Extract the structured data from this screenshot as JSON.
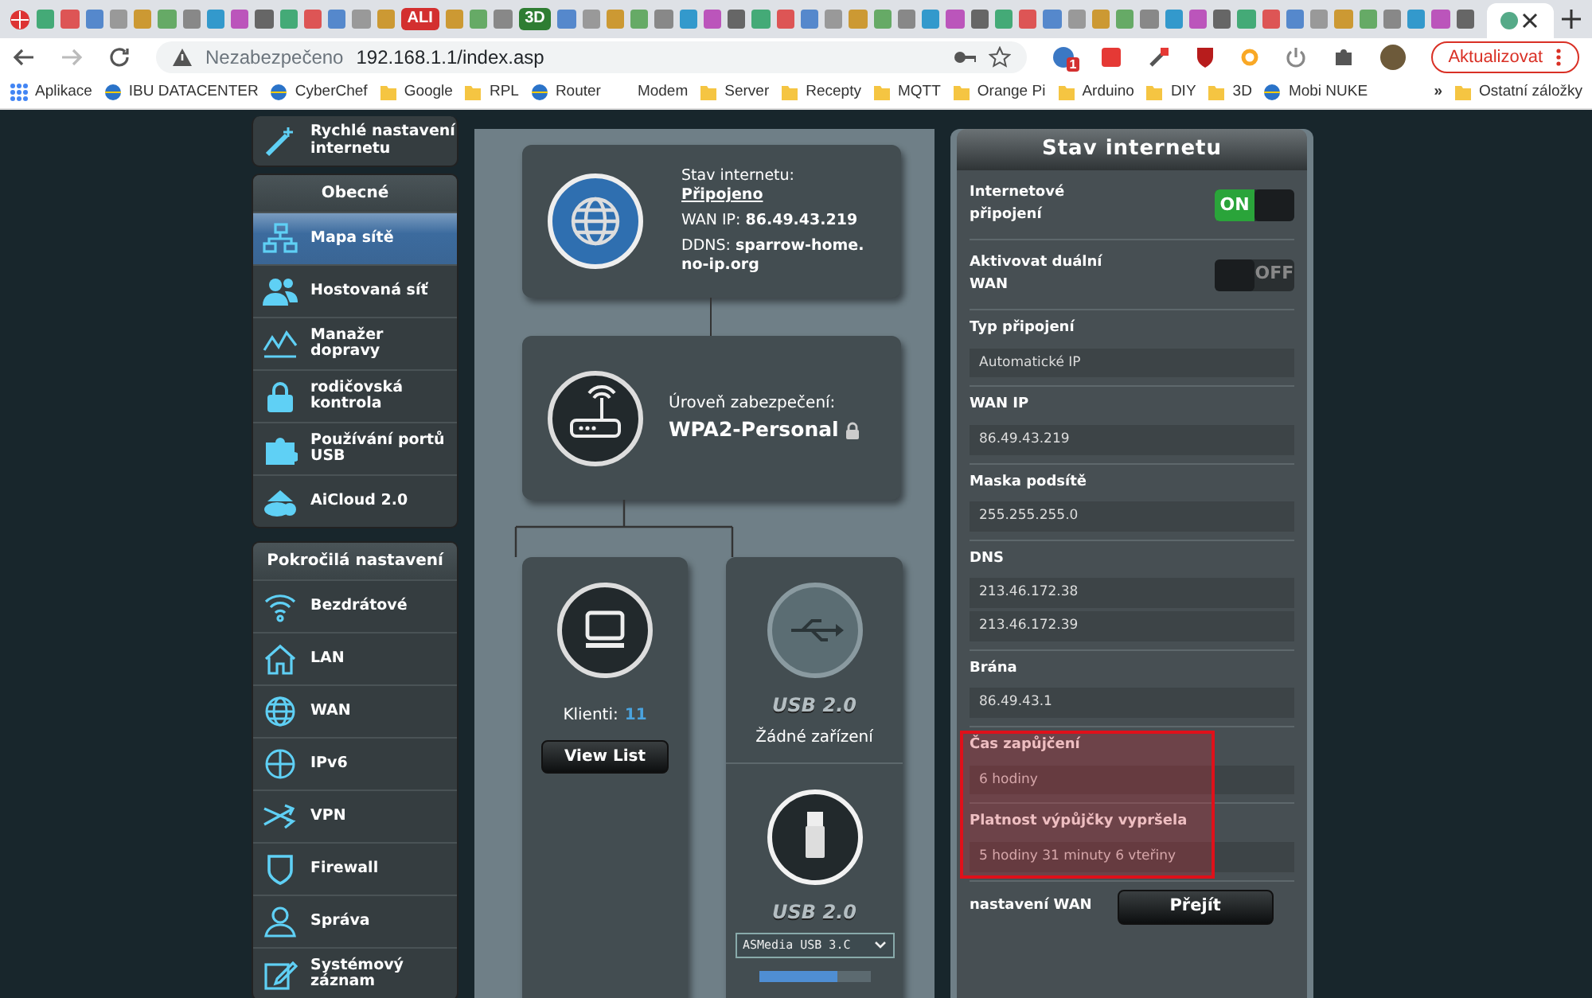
{
  "browser": {
    "tab_badges": [
      {
        "label": "ALI",
        "color": "#d32f2f"
      },
      {
        "label": "3D",
        "color": "#2e7d32"
      }
    ],
    "address": {
      "security": "Nezabezpečeno",
      "url": "192.168.1.1/index.asp"
    },
    "update_button": "Aktualizovat",
    "extension_badge": "1",
    "bookmarks": [
      {
        "label": "Aplikace",
        "kind": "apps"
      },
      {
        "label": "IBU DATACENTER",
        "kind": "site"
      },
      {
        "label": "CyberChef",
        "kind": "site"
      },
      {
        "label": "Google",
        "kind": "folder"
      },
      {
        "label": "RPL",
        "kind": "folder"
      },
      {
        "label": "Router",
        "kind": "site"
      },
      {
        "label": "Modem",
        "kind": "blank"
      },
      {
        "label": "Server",
        "kind": "folder"
      },
      {
        "label": "Recepty",
        "kind": "folder"
      },
      {
        "label": "MQTT",
        "kind": "folder"
      },
      {
        "label": "Orange Pi",
        "kind": "folder"
      },
      {
        "label": "Arduino",
        "kind": "folder"
      },
      {
        "label": "DIY",
        "kind": "folder"
      },
      {
        "label": "3D",
        "kind": "folder"
      },
      {
        "label": "Mobi NUKE",
        "kind": "site"
      }
    ],
    "more": "»",
    "other_bookmarks": "Ostatní záložky"
  },
  "sidebar": {
    "quick_setup": "Rychlé nastavení internetu",
    "groups": [
      {
        "title": "Obecné",
        "items": [
          {
            "label": "Mapa sítě",
            "selected": true
          },
          {
            "label": "Hostovaná síť",
            "selected": false
          },
          {
            "label": "Manažer dopravy",
            "selected": false
          },
          {
            "label": "rodičovská kontrola",
            "selected": false
          },
          {
            "label": "Používání portů USB",
            "selected": false
          },
          {
            "label": "AiCloud 2.0",
            "selected": false
          }
        ]
      },
      {
        "title": "Pokročilá nastavení",
        "items": [
          {
            "label": "Bezdrátové",
            "selected": false
          },
          {
            "label": "LAN",
            "selected": false
          },
          {
            "label": "WAN",
            "selected": false
          },
          {
            "label": "IPv6",
            "selected": false
          },
          {
            "label": "VPN",
            "selected": false
          },
          {
            "label": "Firewall",
            "selected": false
          },
          {
            "label": "Správa",
            "selected": false
          },
          {
            "label": "Systémový záznam",
            "selected": false
          }
        ]
      }
    ]
  },
  "map": {
    "internet": {
      "status_label": "Stav internetu:",
      "status": "Připojeno",
      "wan_label": "WAN IP:",
      "wan_ip": "86.49.43.219",
      "ddns_label": "DDNS:",
      "ddns": "sparrow-home.no-ip.org"
    },
    "security": {
      "label": "Úroveň zabezpečení:",
      "value": "WPA2-Personal"
    },
    "clients": {
      "label": "Klienti:",
      "count": "11",
      "button": "View List"
    },
    "usb": [
      {
        "title": "USB 2.0",
        "status": "Žádné zařízení",
        "connected": false
      },
      {
        "title": "USB 2.0",
        "device": "ASMedia USB 3.C",
        "connected": true,
        "level": 0.7
      }
    ]
  },
  "status": {
    "title": "Stav internetu",
    "rows": [
      {
        "kind": "toggle",
        "label": "Internetové připojení",
        "on": true,
        "text": "ON",
        "highlighted": false
      },
      {
        "kind": "toggle",
        "label": "Aktivovat duální WAN",
        "on": false,
        "text": "OFF",
        "highlighted": false
      },
      {
        "kind": "field",
        "label": "Typ připojení",
        "values": [
          "Automatické IP"
        ],
        "highlighted": false
      },
      {
        "kind": "field",
        "label": "WAN IP",
        "values": [
          "86.49.43.219"
        ],
        "highlighted": false
      },
      {
        "kind": "field",
        "label": "Maska podsítě",
        "values": [
          "255.255.255.0"
        ],
        "highlighted": false
      },
      {
        "kind": "field",
        "label": "DNS",
        "values": [
          "213.46.172.38",
          "213.46.172.39"
        ],
        "highlighted": false
      },
      {
        "kind": "field",
        "label": "Brána",
        "values": [
          "86.49.43.1"
        ],
        "highlighted": false
      },
      {
        "kind": "field",
        "label": "Čas zapůjčení",
        "values": [
          "6 hodiny"
        ],
        "highlighted": true
      },
      {
        "kind": "field",
        "label": "Platnost výpůjčky vypršela",
        "values": [
          "5 hodiny 31 minuty 6 vteřiny"
        ],
        "highlighted": true
      },
      {
        "kind": "button",
        "label": "nastavení WAN",
        "button": "Přejít",
        "highlighted": false
      }
    ]
  }
}
